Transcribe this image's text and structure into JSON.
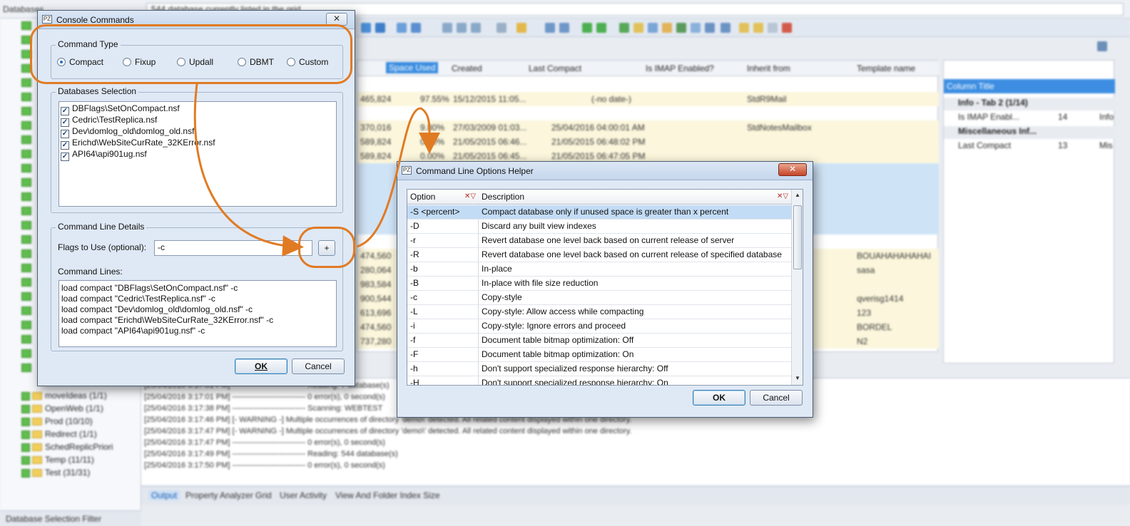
{
  "background": {
    "top_label": "Databases",
    "status_text": "544 database currently listed in the grid",
    "grid_columns": [
      "Space Used",
      "Created",
      "Last Compact",
      "Is IMAP Enabled?",
      "Inherit from",
      "Template name"
    ],
    "grid_rows": [
      {
        "size": "465,824",
        "pct": "97.55%",
        "created": "15/12/2015 11:05...",
        "compact": "(-no date-)",
        "inherit": "StdR9Mail",
        "template": ""
      },
      {
        "size": "370,016",
        "pct": "9.80%",
        "created": "27/03/2009 01:03...",
        "compact": "25/04/2016 04:00:01 AM",
        "inherit": "StdNotesMailbox",
        "template": ""
      },
      {
        "size": "589,824",
        "pct": "0.00%",
        "created": "21/05/2015 06:46...",
        "compact": "21/05/2015 06:48:02 PM",
        "inherit": "",
        "template": ""
      },
      {
        "size": "589,824",
        "pct": "0.00%",
        "created": "21/05/2015 06:45...",
        "compact": "21/05/2015 06:47:05 PM",
        "inherit": "",
        "template": ""
      },
      {
        "size": "474,560",
        "pct": "",
        "created": "",
        "compact": "",
        "inherit": "",
        "template": "BOUAHAHAHAHAI"
      },
      {
        "size": "280,064",
        "pct": "",
        "created": "",
        "compact": "",
        "inherit": "",
        "template": "sasa"
      },
      {
        "size": "983,584",
        "pct": "",
        "created": "",
        "compact": "",
        "inherit": "",
        "template": ""
      },
      {
        "size": "900,544",
        "pct": "",
        "created": "",
        "compact": "",
        "inherit": "",
        "template": "qverisg1414"
      },
      {
        "size": "613,696",
        "pct": "",
        "created": "",
        "compact": "",
        "inherit": "",
        "template": "123"
      },
      {
        "size": "474,560",
        "pct": "",
        "created": "",
        "compact": "",
        "inherit": "",
        "template": "BORDEL"
      },
      {
        "size": "737,280",
        "pct": "",
        "created": "",
        "compact": "",
        "inherit": "",
        "template": "N2"
      }
    ],
    "right_pane": {
      "column_title": "Column Title",
      "rows": [
        {
          "label": "Info - Tab 2 (1/14)",
          "bold": true
        },
        {
          "label": "Is IMAP Enabl...",
          "value": "14",
          "extra": "Info"
        },
        {
          "label": "Miscellaneous Inf...",
          "bold": true
        },
        {
          "label": "Last Compact",
          "value": "13",
          "extra": "Mis"
        }
      ]
    },
    "tree_items": [
      "moveIdeas (1/1)",
      "OpenWeb (1/1)",
      "Prod (10/10)",
      "Redirect (1/1)",
      "SchedReplicPriori",
      "Temp (11/11)",
      "Test (31/31)"
    ],
    "tree_filter": "Database Selection Filter",
    "log_lines": [
      "[25/04/2016 3:17:01 PM] ---------------------------- Reading: 7 database(s)",
      "[25/04/2016 3:17:01 PM] ---------------------------- 0 error(s), 0 second(s)",
      "[25/04/2016 3:17:38 PM] ---------------------------- Scanning: WEBTEST",
      "[25/04/2016 3:17:46 PM] [- WARNING -] Multiple occurrences of directory 'demo\\' detected. All related content displayed within one directory.",
      "[25/04/2016 3:17:47 PM] [- WARNING -] Multiple occurrences of directory 'demo\\' detected. All related content displayed within one directory.",
      "[25/04/2016 3:17:47 PM] ---------------------------- 0 error(s), 0 second(s)",
      "[25/04/2016 3:17:49 PM] ---------------------------- Reading: 544 database(s)",
      "[25/04/2016 3:17:50 PM] ---------------------------- 0 error(s), 0 second(s)"
    ],
    "tabs": [
      "Output",
      "Property Analyzer Grid",
      "User Activity",
      "View And Folder Index Size"
    ]
  },
  "console_dialog": {
    "title": "Console Commands",
    "close_label": "✕",
    "command_type_label": "Command Type",
    "command_types": [
      {
        "label": "Compact",
        "selected": true
      },
      {
        "label": "Fixup",
        "selected": false
      },
      {
        "label": "Updall",
        "selected": false
      },
      {
        "label": "DBMT",
        "selected": false
      },
      {
        "label": "Custom",
        "selected": false
      }
    ],
    "databases_label": "Databases Selection",
    "databases": [
      "DBFlags\\SetOnCompact.nsf",
      "Cedric\\TestReplica.nsf",
      "Dev\\domlog_old\\domlog_old.nsf",
      "Erichd\\WebSiteCurRate_32KError.nsf",
      "API64\\api901ug.nsf"
    ],
    "details_label": "Command Line Details",
    "flags_label": "Flags to Use (optional):",
    "flags_value": "-c",
    "plus_label": "+",
    "command_lines_label": "Command Lines:",
    "command_lines": [
      "load compact \"DBFlags\\SetOnCompact.nsf\"  -c",
      "load compact \"Cedric\\TestReplica.nsf\"  -c",
      "load compact \"Dev\\domlog_old\\domlog_old.nsf\"  -c",
      "load compact \"Erichd\\WebSiteCurRate_32KError.nsf\"  -c",
      "load compact \"API64\\api901ug.nsf\"  -c"
    ],
    "ok_label": "OK",
    "cancel_label": "Cancel"
  },
  "helper_dialog": {
    "title": "Command Line Options Helper",
    "close_label": "✕",
    "col_option": "Option",
    "col_description": "Description",
    "options": [
      {
        "option": "-S <percent>",
        "description": "Compact database only if unused space is greater than x percent"
      },
      {
        "option": "-D",
        "description": "Discard any built view indexes"
      },
      {
        "option": "-r",
        "description": "Revert database one level back based on current release of server"
      },
      {
        "option": "-R",
        "description": "Revert database one level back based on current release of specified database"
      },
      {
        "option": "-b",
        "description": "In-place"
      },
      {
        "option": "-B",
        "description": "In-place with file size reduction"
      },
      {
        "option": "-c",
        "description": "Copy-style"
      },
      {
        "option": "-L",
        "description": "Copy-style: Allow access while compacting"
      },
      {
        "option": "-i",
        "description": "Copy-style: Ignore errors and proceed"
      },
      {
        "option": "-f",
        "description": "Document table bitmap optimization: Off"
      },
      {
        "option": "-F",
        "description": "Document table bitmap optimization: On"
      },
      {
        "option": "-h",
        "description": "Don't support specialized response hierarchy: Off"
      },
      {
        "option": "-H",
        "description": "Don't support specialized response hierarchy: On"
      }
    ],
    "ok_label": "OK",
    "cancel_label": "Cancel"
  },
  "colors": {
    "annotation": "#e07b24",
    "selection": "#c3dcf6",
    "dialog_bg": "#dfe9f5"
  }
}
